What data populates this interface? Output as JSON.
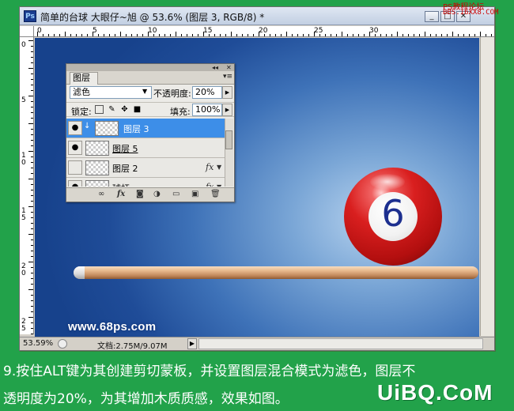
{
  "window": {
    "title": "简单的台球  大眼仔~旭 @ 53.6% (图层 3, RGB/8) *",
    "app_icon": "Ps",
    "controls": {
      "minimize": "_",
      "restore": "□",
      "close": "✕"
    }
  },
  "top_watermark": {
    "line1": "PS教程论坛",
    "line2": "BBS.16XX8.COM"
  },
  "ruler_top": [
    "0",
    "5",
    "10",
    "15",
    "20",
    "25",
    "30"
  ],
  "ruler_left": [
    "0",
    "5",
    "1\n0",
    "1\n5",
    "2\n0",
    "2\n5"
  ],
  "status": {
    "zoom": "53.59%",
    "doc": "文档:2.75M/9.07M"
  },
  "canvas": {
    "ball_number": "6",
    "site_watermark": "www.68ps.com"
  },
  "layers_panel": {
    "collapse_label": "◂◂",
    "close_label": "✕",
    "tab": "图层",
    "menu_icon": "▾≡",
    "blend_mode": "滤色",
    "opacity_label": "不透明度:",
    "opacity_value": "20%",
    "lock_label": "锁定:",
    "fill_label": "填充:",
    "fill_value": "100%",
    "layers": [
      {
        "name": "图层 3",
        "selected": true,
        "visible": true,
        "clipped": true,
        "fx": false
      },
      {
        "name": "图层 5",
        "selected": false,
        "visible": true,
        "clipped": false,
        "fx": false
      },
      {
        "name": "图层 2",
        "selected": false,
        "visible": false,
        "clipped": false,
        "fx": true
      },
      {
        "name": "球杆",
        "selected": false,
        "visible": true,
        "clipped": false,
        "fx": true
      }
    ],
    "fx_label": "fx",
    "footer_icons": [
      "link-icon",
      "fx-icon",
      "mask-icon",
      "adjustment-icon",
      "group-icon",
      "new-layer-icon",
      "delete-icon"
    ]
  },
  "caption": {
    "line1": "9.按住ALT键为其创建剪切蒙板，并设置图层混合模式为滤色，图层不",
    "line2": "透明度为20%，为其增加木质质感，效果如图。"
  },
  "brand": "UiBQ.CoM"
}
